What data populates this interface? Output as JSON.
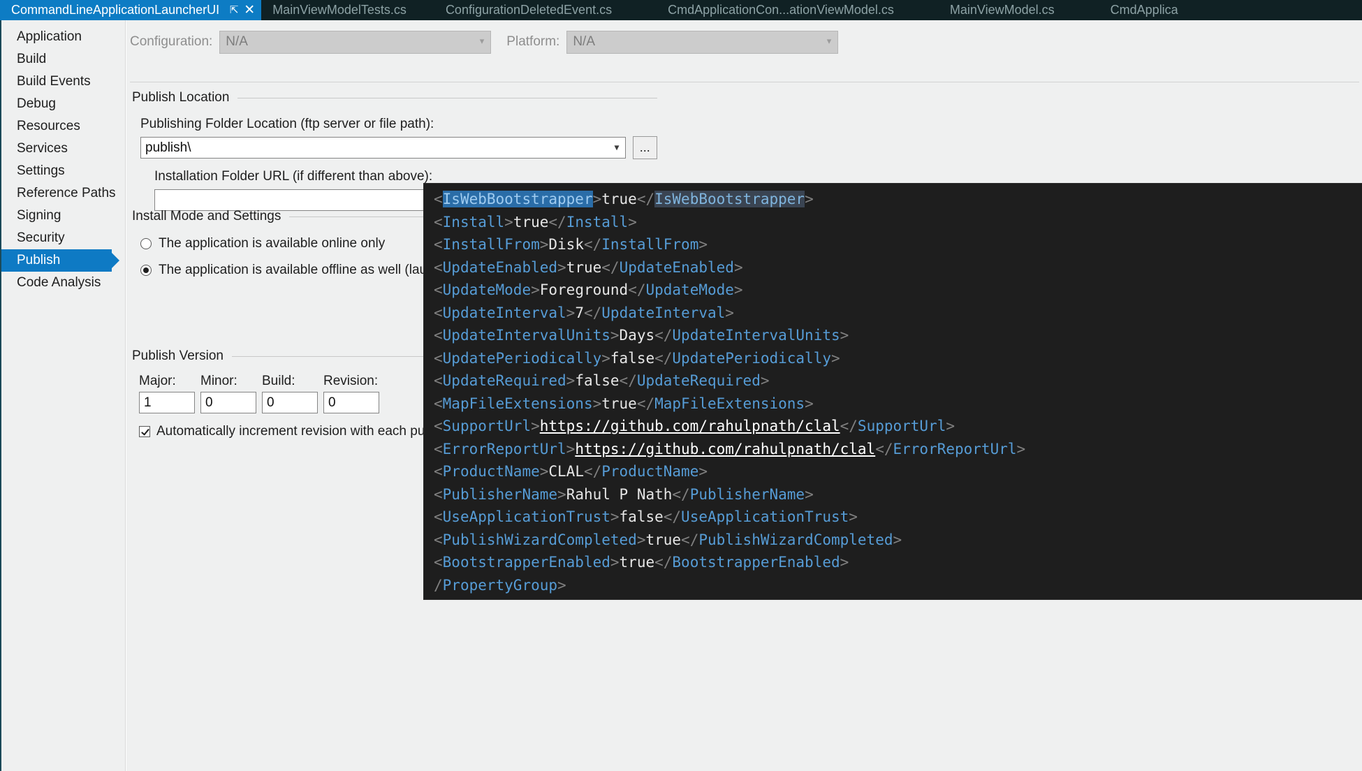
{
  "tabs": [
    {
      "label": "CommandLineApplicationLauncherUI",
      "active": true,
      "pin_icon": "pin-icon",
      "close_icon": "close-icon"
    },
    {
      "label": "MainViewModelTests.cs",
      "active": false
    },
    {
      "label": "ConfigurationDeletedEvent.cs",
      "active": false
    },
    {
      "label": "CmdApplicationCon...ationViewModel.cs",
      "active": false
    },
    {
      "label": "MainViewModel.cs",
      "active": false
    },
    {
      "label": "CmdApplica",
      "active": false
    }
  ],
  "sidebar": {
    "items": [
      {
        "label": "Application",
        "selected": false
      },
      {
        "label": "Build",
        "selected": false
      },
      {
        "label": "Build Events",
        "selected": false
      },
      {
        "label": "Debug",
        "selected": false
      },
      {
        "label": "Resources",
        "selected": false
      },
      {
        "label": "Services",
        "selected": false
      },
      {
        "label": "Settings",
        "selected": false
      },
      {
        "label": "Reference Paths",
        "selected": false
      },
      {
        "label": "Signing",
        "selected": false
      },
      {
        "label": "Security",
        "selected": false
      },
      {
        "label": "Publish",
        "selected": true
      },
      {
        "label": "Code Analysis",
        "selected": false
      }
    ]
  },
  "toolbar": {
    "configuration_label": "Configuration:",
    "configuration_value": "N/A",
    "platform_label": "Platform:",
    "platform_value": "N/A"
  },
  "publish_location": {
    "group_title": "Publish Location",
    "folder_label": "Publishing Folder Location (ftp server or file path):",
    "folder_value": "publish\\",
    "folder_browse_label": "...",
    "install_url_label": "Installation Folder URL (if different than above):",
    "install_url_value": "",
    "install_url_browse_label": "..."
  },
  "install_mode": {
    "group_title": "Install Mode and Settings",
    "option_online": "The application is available online only",
    "option_offline": "The application is available offline as well (launchable from Start Menu)",
    "selected": "offline"
  },
  "publish_version": {
    "group_title": "Publish Version",
    "fields": [
      {
        "label": "Major:",
        "value": "1"
      },
      {
        "label": "Minor:",
        "value": "0"
      },
      {
        "label": "Build:",
        "value": "0"
      },
      {
        "label": "Revision:",
        "value": "0"
      }
    ],
    "auto_increment_label": "Automatically increment revision with each publish",
    "auto_increment_checked": true
  },
  "xml_overlay": {
    "lines": [
      {
        "open_lt": "<",
        "tag": "IsWebBootstrapper",
        "tag_style": "sel-bright",
        "open_gt": ">",
        "value": "true",
        "close": "</",
        "close_tag": "IsWebBootstrapper",
        "close_tag_style": "sel-dim",
        "close_gt": ">"
      },
      {
        "open_lt": "<",
        "tag": "Install",
        "open_gt": ">",
        "value": "true",
        "close": "</",
        "close_tag": "Install",
        "close_gt": ">"
      },
      {
        "open_lt": "<",
        "tag": "InstallFrom",
        "open_gt": ">",
        "value": "Disk",
        "close": "</",
        "close_tag": "InstallFrom",
        "close_gt": ">"
      },
      {
        "open_lt": "<",
        "tag": "UpdateEnabled",
        "open_gt": ">",
        "value": "true",
        "close": "</",
        "close_tag": "UpdateEnabled",
        "close_gt": ">"
      },
      {
        "open_lt": "<",
        "tag": "UpdateMode",
        "open_gt": ">",
        "value": "Foreground",
        "close": "</",
        "close_tag": "UpdateMode",
        "close_gt": ">"
      },
      {
        "open_lt": "<",
        "tag": "UpdateInterval",
        "open_gt": ">",
        "value": "7",
        "close": "</",
        "close_tag": "UpdateInterval",
        "close_gt": ">"
      },
      {
        "open_lt": "<",
        "tag": "UpdateIntervalUnits",
        "open_gt": ">",
        "value": "Days",
        "close": "</",
        "close_tag": "UpdateIntervalUnits",
        "close_gt": ">"
      },
      {
        "open_lt": "<",
        "tag": "UpdatePeriodically",
        "open_gt": ">",
        "value": "false",
        "close": "</",
        "close_tag": "UpdatePeriodically",
        "close_gt": ">"
      },
      {
        "open_lt": "<",
        "tag": "UpdateRequired",
        "open_gt": ">",
        "value": "false",
        "close": "</",
        "close_tag": "UpdateRequired",
        "close_gt": ">"
      },
      {
        "open_lt": "<",
        "tag": "MapFileExtensions",
        "open_gt": ">",
        "value": "true",
        "close": "</",
        "close_tag": "MapFileExtensions",
        "close_gt": ">"
      },
      {
        "open_lt": "<",
        "tag": "SupportUrl",
        "open_gt": ">",
        "value": "https://github.com/rahulpnath/clal",
        "value_style": "url",
        "close": "</",
        "close_tag": "SupportUrl",
        "close_gt": ">"
      },
      {
        "open_lt": "<",
        "tag": "ErrorReportUrl",
        "open_gt": ">",
        "value": "https://github.com/rahulpnath/clal",
        "value_style": "url",
        "close": "</",
        "close_tag": "ErrorReportUrl",
        "close_gt": ">"
      },
      {
        "open_lt": "<",
        "tag": "ProductName",
        "open_gt": ">",
        "value": "CLAL",
        "close": "</",
        "close_tag": "ProductName",
        "close_gt": ">"
      },
      {
        "open_lt": "<",
        "tag": "PublisherName",
        "open_gt": ">",
        "value": "Rahul P Nath",
        "close": "</",
        "close_tag": "PublisherName",
        "close_gt": ">"
      },
      {
        "open_lt": "<",
        "tag": "UseApplicationTrust",
        "open_gt": ">",
        "value": "false",
        "close": "</",
        "close_tag": "UseApplicationTrust",
        "close_gt": ">"
      },
      {
        "open_lt": "<",
        "tag": "PublishWizardCompleted",
        "open_gt": ">",
        "value": "true",
        "close": "</",
        "close_tag": "PublishWizardCompleted",
        "close_gt": ">"
      },
      {
        "open_lt": "<",
        "tag": "BootstrapperEnabled",
        "open_gt": ">",
        "value": "true",
        "close": "</",
        "close_tag": "BootstrapperEnabled",
        "close_gt": ">"
      },
      {
        "open_lt": "",
        "tag": "",
        "open_gt": "",
        "value": "",
        "close": "/",
        "close_tag": "PropertyGroup",
        "close_gt": ">"
      }
    ]
  },
  "colors": {
    "accent": "#0e7ac4",
    "tabstrip_bg": "#102124",
    "pane_bg": "#eff0f0",
    "editor_bg": "#1e1e1e",
    "xml_tag": "#569cd6",
    "xml_punct": "#808080",
    "xml_value": "#e6e6e6"
  }
}
